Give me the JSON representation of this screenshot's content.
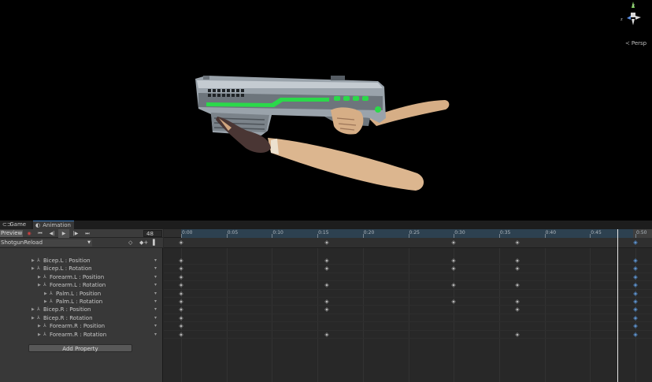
{
  "scene": {
    "view_mode": "Persp",
    "gizmo_axes": {
      "y": "y",
      "z": "z"
    },
    "colors": {
      "gun_body": "#9aa3ab",
      "gun_glow": "#2bd94a",
      "arm_skin": "#d9b48f",
      "glove": "#4a3634",
      "background": "#000000"
    }
  },
  "tabs": [
    {
      "label": "Game",
      "icon": "gamepad-icon"
    },
    {
      "label": "Animation",
      "icon": "animation-icon"
    }
  ],
  "controls": {
    "preview_label": "Preview",
    "frame": "48",
    "clip_name": "ShotgunReload"
  },
  "properties": [
    {
      "label": "Bicep.L : Position",
      "indent": 0
    },
    {
      "label": "Bicep.L : Rotation",
      "indent": 0
    },
    {
      "label": "Forearm.L : Position",
      "indent": 1
    },
    {
      "label": "Forearm.L : Rotation",
      "indent": 1
    },
    {
      "label": "Palm.L : Position",
      "indent": 2
    },
    {
      "label": "Palm.L : Rotation",
      "indent": 2
    },
    {
      "label": "Bicep.R : Position",
      "indent": 0
    },
    {
      "label": "Bicep.R : Rotation",
      "indent": 0
    },
    {
      "label": "Forearm.R : Position",
      "indent": 1
    },
    {
      "label": "Forearm.R : Rotation",
      "indent": 1
    }
  ],
  "add_property_label": "Add Property",
  "timeline": {
    "ticks": [
      "0:00",
      "0:05",
      "0:10",
      "0:15",
      "0:20",
      "0:25",
      "0:30",
      "0:35",
      "0:40",
      "0:45",
      "0:50"
    ],
    "tick_values": [
      0,
      5,
      10,
      15,
      20,
      25,
      30,
      35,
      40,
      45,
      50
    ],
    "playhead_frame": 48,
    "summary_keys": [
      0,
      16,
      30,
      37,
      50
    ],
    "track_keys": [
      [
        0,
        16,
        30,
        37,
        50
      ],
      [
        0,
        16,
        30,
        37,
        50
      ],
      [
        0,
        50
      ],
      [
        0,
        16,
        30,
        37,
        50
      ],
      [
        0,
        50
      ],
      [
        0,
        16,
        30,
        37,
        50
      ],
      [
        0,
        16,
        37,
        50
      ],
      [
        0,
        50
      ],
      [
        0,
        50
      ],
      [
        0,
        16,
        37,
        50
      ]
    ]
  }
}
